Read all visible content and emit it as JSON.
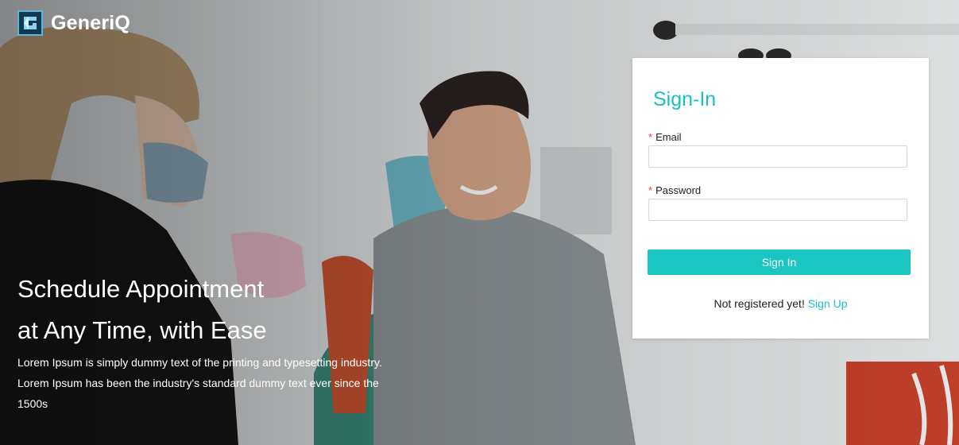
{
  "brand": {
    "name": "GeneriQ",
    "icon": "generiq-logo-icon"
  },
  "hero": {
    "headline_line1": "Schedule Appointment",
    "headline_line2": "at Any Time, with Ease",
    "blurb": "Lorem Ipsum is simply dummy text of the printing and typesetting industry. Lorem Ipsum has been the industry's standard dummy text ever since the 1500s",
    "image": "dentist-and-smiling-patient-photo"
  },
  "signin": {
    "title": "Sign-In",
    "required_mark": "*",
    "email_label": "Email",
    "email_value": "",
    "password_label": "Password",
    "password_value": "",
    "button_label": "Sign In",
    "register_prompt": "Not registered yet!",
    "register_link": "Sign Up"
  },
  "colors": {
    "accent": "#1bc5c2",
    "required": "#e53935",
    "card": "#ffffff"
  }
}
